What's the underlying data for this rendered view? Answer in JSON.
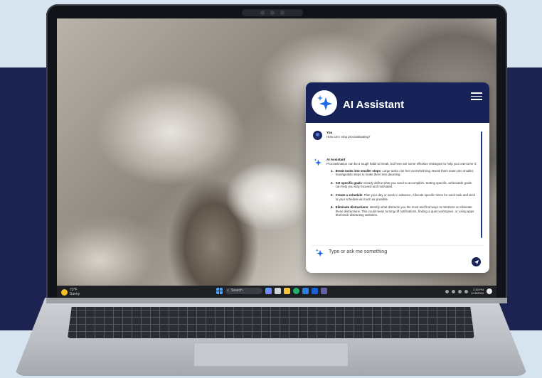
{
  "assistant": {
    "title": "AI Assistant",
    "user_name": "You",
    "user_message": "How can I stop procrastinating?",
    "ai_name": "AI Assistant",
    "ai_intro": "Procrastination can be a tough habit to break, but here are some effective strategies to help you overcome it:",
    "tips": [
      {
        "num": "1.",
        "title": "Break tasks into smaller steps",
        "text": ": Large tasks can feel overwhelming. Break them down into smaller, manageable steps to make them less daunting."
      },
      {
        "num": "2.",
        "title": "Set specific goals",
        "text": ": Clearly define what you need to accomplish. Setting specific, achievable goals can help you stay focused and motivated."
      },
      {
        "num": "3.",
        "title": "Create a schedule",
        "text": ": Plan your day or week in advance. Allocate specific times for each task and stick to your schedule as much as possible."
      },
      {
        "num": "4.",
        "title": "Eliminate distractions",
        "text": ": Identify what distracts you the most and find ways to minimize or eliminate these distractions. This could mean turning off notifications, finding a quiet workspace, or using apps that block distracting websites."
      }
    ],
    "input_placeholder": "Type or ask me something"
  },
  "taskbar": {
    "weather_temp": "73°F",
    "weather_desc": "Sunny",
    "search_label": "Search",
    "time": "2:30 PM",
    "date": "1/15/2024"
  },
  "colors": {
    "background": "#d6e4ef",
    "band": "#1c2350",
    "panel_header": "#162258",
    "taskbar": "#1e2024"
  }
}
